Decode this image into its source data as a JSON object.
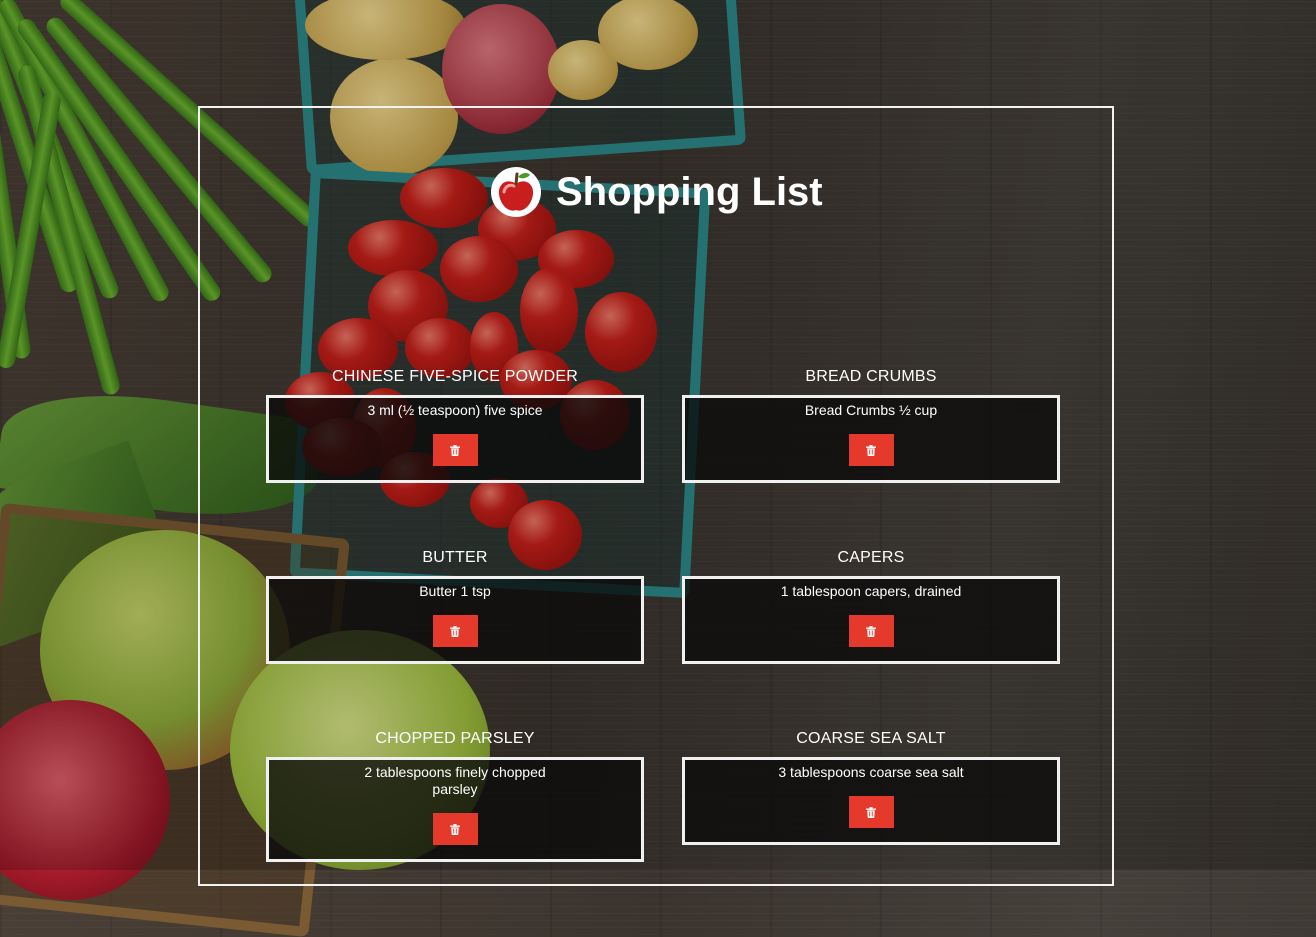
{
  "page": {
    "title": "Shopping List",
    "logo_icon": "apple-icon"
  },
  "colors": {
    "frame": "#f2f2f2",
    "card_bg": "#0a0a0a",
    "delete_button": "#e5392c",
    "text": "#ffffff"
  },
  "items": [
    {
      "name": "CHINESE FIVE-SPICE POWDER",
      "detail": "3 ml (½ teaspoon) five spice",
      "action_icon": "trash-icon"
    },
    {
      "name": "BREAD CRUMBS",
      "detail": "Bread Crumbs ½ cup",
      "action_icon": "trash-icon"
    },
    {
      "name": "BUTTER",
      "detail": "Butter 1 tsp",
      "action_icon": "trash-icon"
    },
    {
      "name": "CAPERS",
      "detail": "1 tablespoon capers, drained",
      "action_icon": "trash-icon"
    },
    {
      "name": "CHOPPED PARSLEY",
      "detail": "2 tablespoons finely chopped parsley",
      "action_icon": "trash-icon"
    },
    {
      "name": "COARSE SEA SALT",
      "detail": "3 tablespoons coarse sea salt",
      "action_icon": "trash-icon"
    }
  ]
}
